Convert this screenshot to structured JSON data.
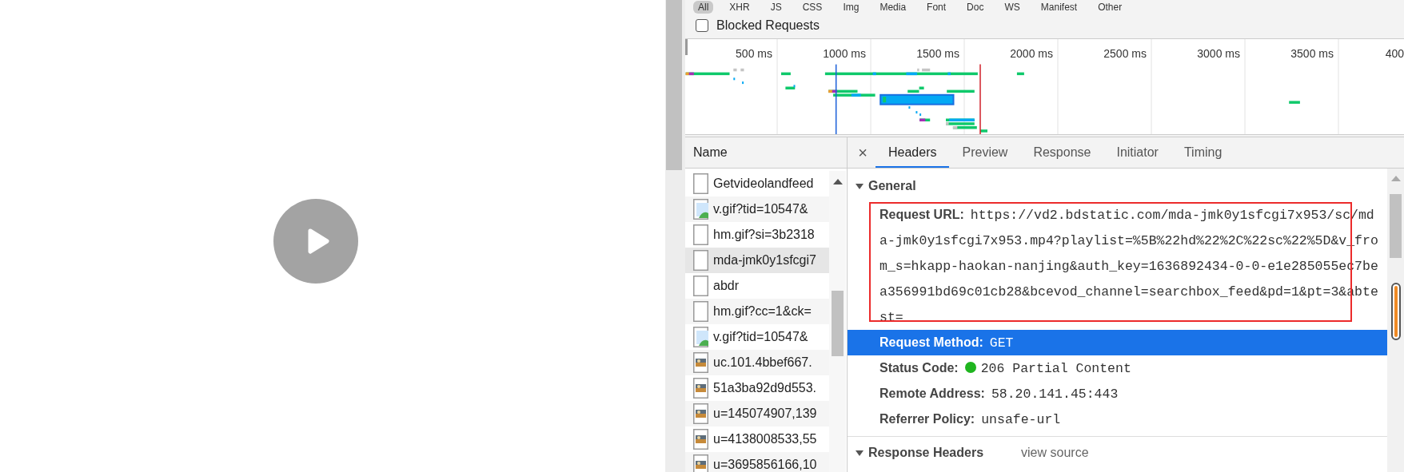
{
  "filter_bar": {
    "buttons": [
      {
        "label": "All",
        "selected": true
      },
      {
        "label": "XHR",
        "selected": false
      },
      {
        "label": "JS",
        "selected": false
      },
      {
        "label": "CSS",
        "selected": false
      },
      {
        "label": "Img",
        "selected": false
      },
      {
        "label": "Media",
        "selected": false
      },
      {
        "label": "Font",
        "selected": false
      },
      {
        "label": "Doc",
        "selected": false
      },
      {
        "label": "WS",
        "selected": false
      },
      {
        "label": "Manifest",
        "selected": false
      },
      {
        "label": "Other",
        "selected": false
      }
    ]
  },
  "blocked_requests": {
    "label": "Blocked Requests",
    "checked": false
  },
  "timeline": {
    "ruler_labels": [
      "500 ms",
      "1000 ms",
      "1500 ms",
      "2000 ms",
      "2500 ms",
      "3000 ms",
      "3500 ms",
      "400"
    ]
  },
  "requests": {
    "column": "Name",
    "rows": [
      {
        "name": "Getvideolandfeed",
        "kind": "document",
        "selected": false
      },
      {
        "name": "v.gif?tid=10547&",
        "kind": "image",
        "selected": false
      },
      {
        "name": "hm.gif?si=3b2318",
        "kind": "document",
        "selected": false
      },
      {
        "name": "mda-jmk0y1sfcgi7",
        "kind": "document",
        "selected": true
      },
      {
        "name": "abdr",
        "kind": "document",
        "selected": false
      },
      {
        "name": "hm.gif?cc=1&ck=",
        "kind": "document",
        "selected": false
      },
      {
        "name": "v.gif?tid=10547&",
        "kind": "image",
        "selected": false
      },
      {
        "name": "uc.101.4bbef667.",
        "kind": "thumbnail",
        "selected": false
      },
      {
        "name": "51a3ba92d9d553.",
        "kind": "thumbnail",
        "selected": false
      },
      {
        "name": "u=145074907,139",
        "kind": "thumbnail",
        "selected": false
      },
      {
        "name": "u=4138008533,55",
        "kind": "thumbnail",
        "selected": false
      },
      {
        "name": "u=3695856166,10",
        "kind": "thumbnail",
        "selected": false
      }
    ]
  },
  "details": {
    "close_glyph": "×",
    "tabs": [
      {
        "label": "Headers",
        "selected": true
      },
      {
        "label": "Preview",
        "selected": false
      },
      {
        "label": "Response",
        "selected": false
      },
      {
        "label": "Initiator",
        "selected": false
      },
      {
        "label": "Timing",
        "selected": false
      }
    ],
    "sections": [
      {
        "title": "General",
        "expanded": true,
        "rows": [
          {
            "label": "Request URL:",
            "value": "https://vd2.bdstatic.com/mda-jmk0y1sfcgi7x953/sc/mda-jmk0y1sfcgi7x953.mp4?playlist=%5B%22hd%22%2C%22sc%22%5D&v_from_s=hkapp-haokan-nanjing&auth_key=1636892434-0-0-e1e285055ec7bea356991bd69c01cb28&bcevod_channel=searchbox_feed&pd=1&pt=3&abtest=",
            "selected": false,
            "annotated": true
          },
          {
            "label": "Request Method:",
            "value": "GET",
            "selected": true,
            "annotated": false
          },
          {
            "label": "Status Code:",
            "value": "206 Partial Content",
            "color": "#1fb51f",
            "selected": false,
            "annotated": false
          },
          {
            "label": "Remote Address:",
            "value": "58.20.141.45:443",
            "selected": false,
            "annotated": false
          },
          {
            "label": "Referrer Policy:",
            "value": "unsafe-url",
            "selected": false,
            "annotated": false
          }
        ]
      },
      {
        "title": "Response Headers",
        "expanded": true,
        "link": "view source"
      }
    ]
  }
}
